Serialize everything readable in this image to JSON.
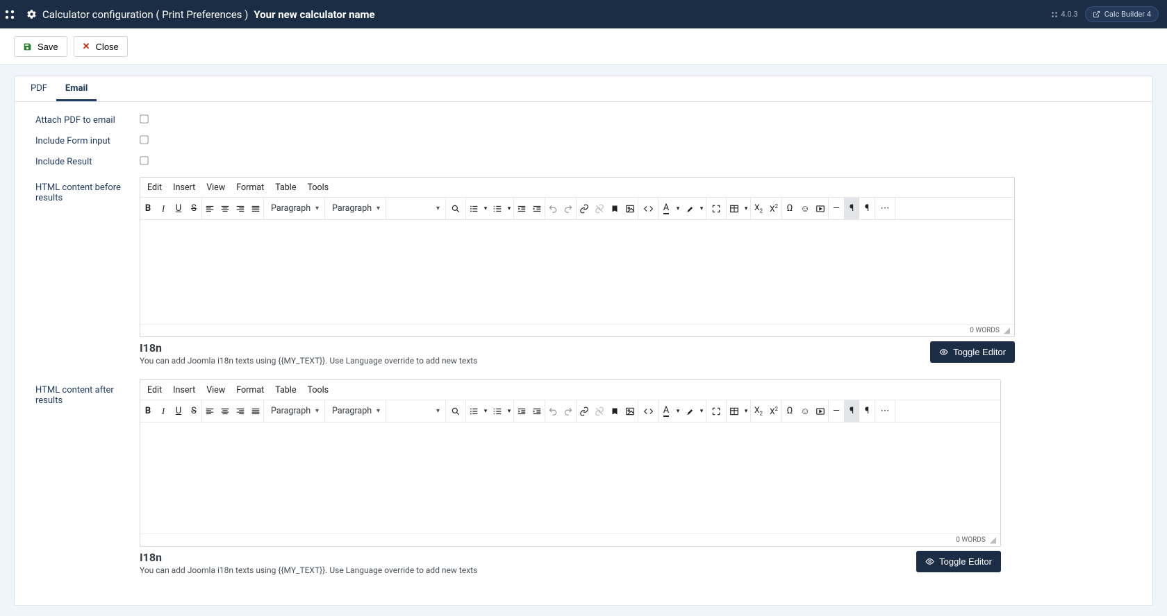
{
  "header": {
    "title_prefix": "Calculator configuration ( Print Preferences )",
    "title_bold": "Your new calculator name",
    "version": "4.0.3",
    "badge_label": "Calc Builder 4"
  },
  "toolbar": {
    "save_label": "Save",
    "close_label": "Close"
  },
  "tabs": {
    "pdf": "PDF",
    "email": "Email"
  },
  "form": {
    "attach_pdf_label": "Attach PDF to email",
    "include_form_label": "Include Form input",
    "include_result_label": "Include Result",
    "before_label": "HTML content before results",
    "after_label": "HTML content after results",
    "attach_pdf_checked": false,
    "include_form_checked": false,
    "include_result_checked": false
  },
  "editor": {
    "menus": [
      "Edit",
      "Insert",
      "View",
      "Format",
      "Table",
      "Tools"
    ],
    "format_select": "Paragraph",
    "style_select": "Paragraph",
    "font_select": "",
    "wordcount": "0 WORDS"
  },
  "i18n": {
    "title": "I18n",
    "sub": "You can add Joomla i18n texts using {{MY_TEXT}}. Use Language override to add new texts",
    "toggle_label": "Toggle Editor"
  }
}
